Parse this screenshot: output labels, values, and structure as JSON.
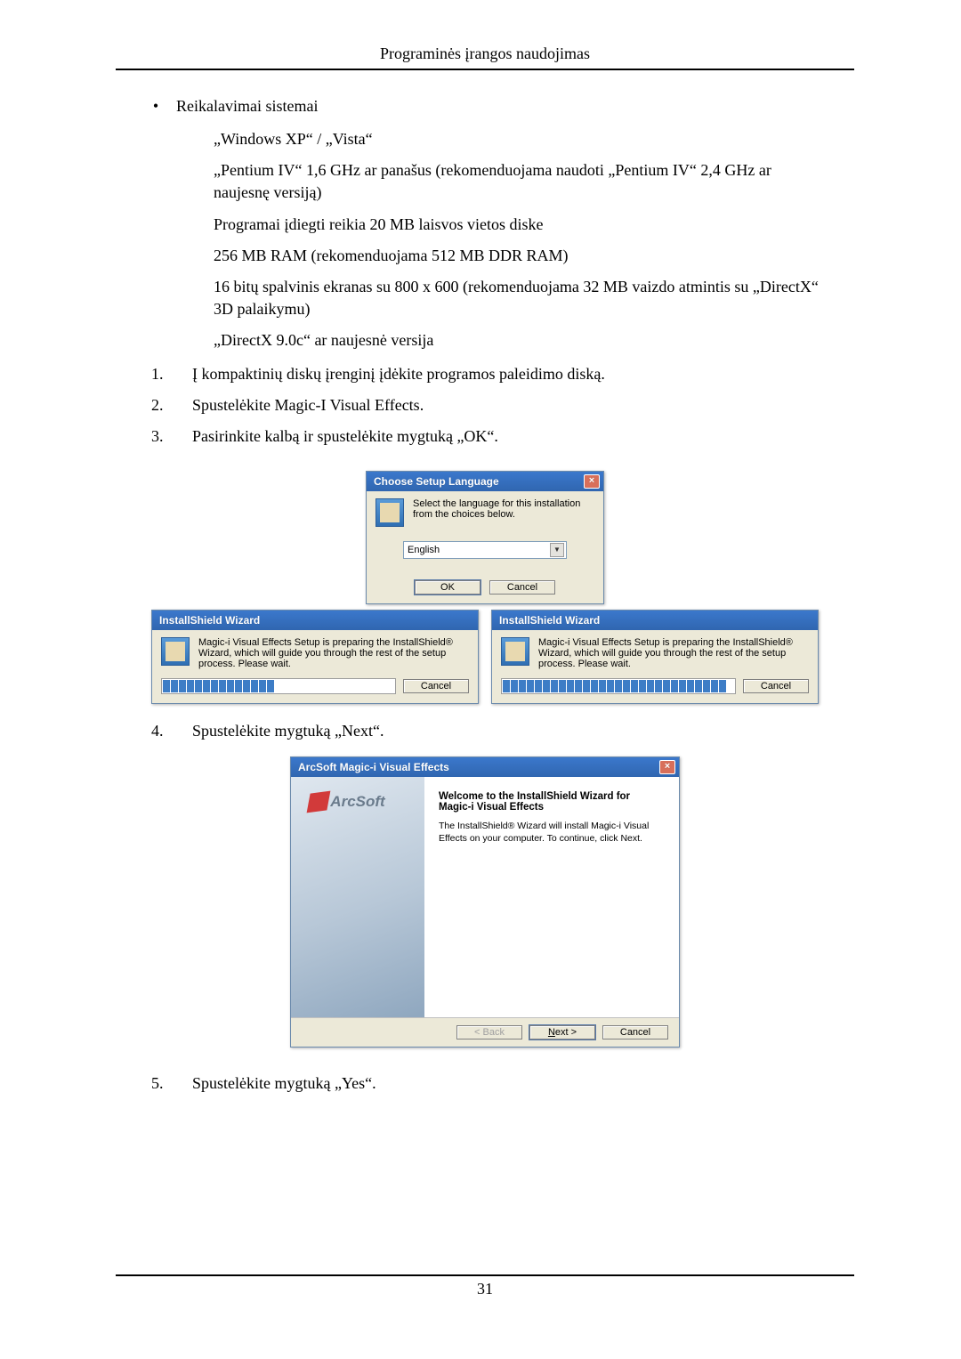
{
  "header": {
    "title": "Programinės įrangos naudojimas"
  },
  "footer": {
    "pagenum": "31"
  },
  "bullet": {
    "title": "Reikalavimai sistemai"
  },
  "reqs": {
    "r1": "„Windows XP“ / „Vista“",
    "r2": "„Pentium IV“ 1,6 GHz ar panašus (rekomenduojama naudoti „Pentium IV“ 2,4 GHz ar naujesnę versiją)",
    "r3": "Programai įdiegti reikia 20 MB laisvos vietos diske",
    "r4": "256 MB RAM (rekomenduojama 512 MB DDR RAM)",
    "r5": "16 bitų spalvinis ekranas su 800 x 600 (rekomenduojama 32 MB vaizdo atmintis su „DirectX“ 3D palaikymu)",
    "r6": "„DirectX 9.0c“ ar naujesnė versija"
  },
  "steps": {
    "s1n": "1.",
    "s1": "Į kompaktinių diskų įrenginį įdėkite programos paleidimo diską.",
    "s2n": "2.",
    "s2": "Spustelėkite Magic-I Visual Effects.",
    "s3n": "3.",
    "s3": "Pasirinkite kalbą ir spustelėkite mygtuką „OK“.",
    "s4n": "4.",
    "s4": "Spustelėkite mygtuką „Next“.",
    "s5n": "5.",
    "s5": "Spustelėkite mygtuką „Yes“."
  },
  "dlg_lang": {
    "title": "Choose Setup Language",
    "msg": "Select the language for this installation from the choices below.",
    "selected": "English",
    "ok": "OK",
    "cancel": "Cancel"
  },
  "dlg_wizard": {
    "title": "InstallShield Wizard",
    "msg": "Magic-i Visual Effects Setup is preparing the InstallShield® Wizard, which will guide you through the rest of the setup process. Please wait.",
    "cancel": "Cancel"
  },
  "dlg_arcsoft": {
    "title": "ArcSoft Magic-i Visual Effects",
    "brand": "ArcSoft",
    "heading": "Welcome to the InstallShield Wizard for Magic-i Visual Effects",
    "text": "The InstallShield® Wizard will install Magic-i Visual Effects on your computer.  To continue, click Next.",
    "back": "< Back",
    "next": "Next >",
    "cancel": "Cancel"
  }
}
